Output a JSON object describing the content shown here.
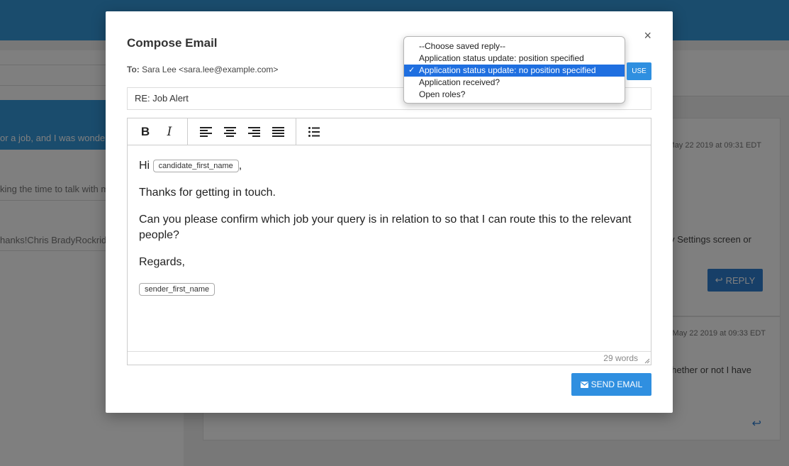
{
  "background": {
    "left_snippets": [
      "or a job, and I was wondering",
      "king the time to talk with m",
      "hanks!Chris BradyRockridge"
    ],
    "cards": [
      {
        "date": "May 22 2019 at 09:31 EDT",
        "body": "y Settings screen or",
        "reply_label": "REPLY"
      },
      {
        "date": "May 22 2019 at 09:33 EDT",
        "body": "hether or not I have"
      }
    ]
  },
  "modal": {
    "title": "Compose Email",
    "close_glyph": "×",
    "to_label": "To:",
    "to_value": "Sara Lee <sara.lee@example.com>",
    "subject": "RE: Job Alert",
    "body": {
      "greeting": "Hi",
      "candidate_tag": "candidate_first_name",
      "greeting_punct": ",",
      "para1": "Thanks for getting in touch.",
      "para2": "Can you please confirm which job your query is in relation to so that I can route this to the relevant people?",
      "closing": "Regards,",
      "sender_tag": "sender_first_name"
    },
    "word_count": "29 words",
    "send_label": "SEND EMAIL"
  },
  "saved_reply": {
    "options": [
      "--Choose saved reply--",
      "Application status update: position specified",
      "Application status update: no position specified",
      "Application received?",
      "Open roles?"
    ],
    "selected_index": 2,
    "check_glyph": "✓",
    "use_label": "USE"
  }
}
